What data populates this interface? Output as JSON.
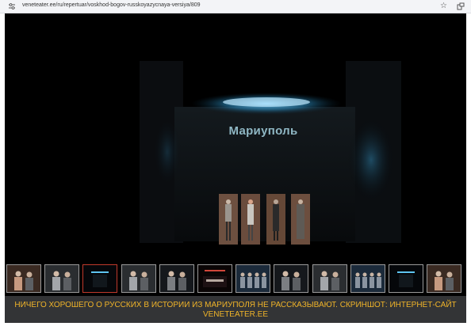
{
  "browser": {
    "url": "veneteater.ee/ru/repertuar/voskhod-bogov-russkoyazycnaya-versiya/809",
    "tune_icon": "page-info-icon",
    "star_icon": "bookmark-star-icon",
    "ext_icon": "extensions-icon"
  },
  "gallery": {
    "stage_title": "Мариуполь",
    "thumbnails": [
      {
        "name": "thumb-1",
        "kind": "people-warm"
      },
      {
        "name": "thumb-2",
        "kind": "people-gray"
      },
      {
        "name": "thumb-3",
        "kind": "stage-blue",
        "active": true
      },
      {
        "name": "thumb-4",
        "kind": "people-gray"
      },
      {
        "name": "thumb-5",
        "kind": "people-dark"
      },
      {
        "name": "thumb-6",
        "kind": "stage-red"
      },
      {
        "name": "thumb-7",
        "kind": "people-row"
      },
      {
        "name": "thumb-8",
        "kind": "people-dark"
      },
      {
        "name": "thumb-9",
        "kind": "people-gray"
      },
      {
        "name": "thumb-10",
        "kind": "people-row"
      },
      {
        "name": "thumb-11",
        "kind": "stage-blue"
      },
      {
        "name": "thumb-12",
        "kind": "people-warm"
      }
    ]
  },
  "caption": {
    "text": "НИЧЕГО ХОРОШЕГО О РУССКИХ В ИСТОРИИ ИЗ МАРИУПОЛЯ НЕ РАССКАЗЫВАЮТ. СКРИНШОТ: ИНТЕРНЕТ-САЙТ VENETEATER.EE"
  },
  "colors": {
    "caption_text": "#f0b429",
    "caption_bg": "#333436",
    "active_thumb_border": "#c0392b",
    "stage_light": "#3aa6d8"
  }
}
